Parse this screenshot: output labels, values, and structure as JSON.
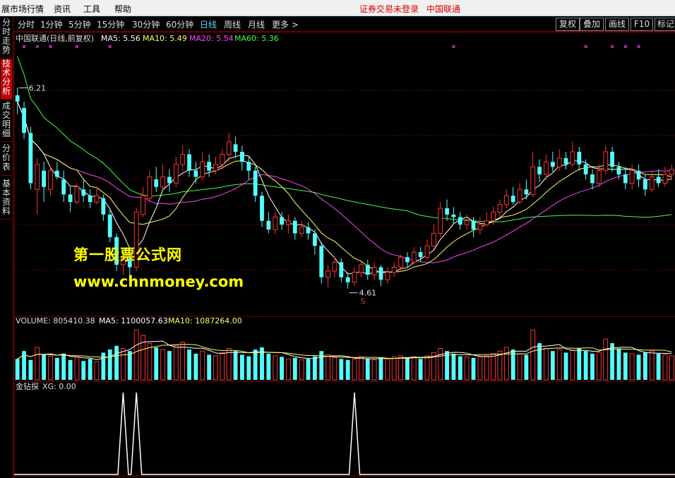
{
  "menu": {
    "items": [
      "展市场行情",
      "资讯",
      "工具",
      "帮助"
    ],
    "warning": "证券交易未登录",
    "stock": "中国联通"
  },
  "sidebar": {
    "tabs": [
      "分时走势",
      "技术分析",
      "成交明细",
      "分价表",
      "基本资料"
    ],
    "active": 1
  },
  "toolbar": {
    "periods": [
      "分时",
      "1分钟",
      "5分钟",
      "15分钟",
      "30分钟",
      "60分钟",
      "日线",
      "周线",
      "月线",
      "更多 >"
    ],
    "active": 6,
    "right_buttons": [
      "复权",
      "叠加",
      "画线",
      "F10",
      "标记"
    ]
  },
  "price_panel": {
    "title": "中国联通(日线,前复权)",
    "indicators": [
      {
        "label": "MA5: 5.56",
        "color": "#ffffff"
      },
      {
        "label": "MA10: 5.49",
        "color": "#ffff66"
      },
      {
        "label": "MA20: 5.54",
        "color": "#ff44ff"
      },
      {
        "label": "MA60: 5.36",
        "color": "#44ff44"
      }
    ],
    "high_label": "6.21",
    "low_label": "4.61",
    "low_marker": "S"
  },
  "volume_panel": {
    "title": "VOLUME: 805410.38",
    "indicators": [
      {
        "label": "MA5: 1100057.63",
        "color": "#ffffff"
      },
      {
        "label": "MA10: 1087264.00",
        "color": "#ffff66"
      }
    ]
  },
  "signal_panel": {
    "title": "金钻探",
    "value": "XG: 0.00"
  },
  "watermark": {
    "line1": "第一股票公式网",
    "line2": "www.chnmoney.com"
  },
  "colors": {
    "up": "#ff3333",
    "down": "#54ffff",
    "ma5": "#ffffff",
    "ma10": "#ffff66",
    "ma20": "#ff44ff",
    "ma60": "#44ff44",
    "marks": "#ff44ff"
  },
  "chart_data": {
    "type": "candlestick",
    "price_ylim": [
      4.4,
      6.55
    ],
    "candles": [
      [
        6.15,
        6.1,
        6.21,
        6.0
      ],
      [
        6.05,
        5.85,
        6.1,
        5.8
      ],
      [
        5.85,
        5.45,
        5.9,
        5.4
      ],
      [
        5.4,
        5.6,
        5.65,
        5.2
      ],
      [
        5.55,
        5.42,
        5.62,
        5.3
      ],
      [
        5.4,
        5.55,
        5.58,
        5.35
      ],
      [
        5.55,
        5.5,
        5.62,
        5.48
      ],
      [
        5.48,
        5.36,
        5.55,
        5.3
      ],
      [
        5.36,
        5.3,
        5.42,
        5.22
      ],
      [
        5.3,
        5.42,
        5.45,
        5.28
      ],
      [
        5.4,
        5.35,
        5.48,
        5.3
      ],
      [
        5.35,
        5.3,
        5.4,
        5.25
      ],
      [
        5.3,
        5.35,
        5.42,
        5.28
      ],
      [
        5.33,
        5.2,
        5.36,
        5.15
      ],
      [
        5.2,
        5.02,
        5.25,
        4.98
      ],
      [
        5.02,
        4.8,
        5.05,
        4.75
      ],
      [
        4.8,
        4.85,
        4.92,
        4.72
      ],
      [
        4.85,
        4.78,
        4.9,
        4.7
      ],
      [
        4.78,
        5.22,
        5.25,
        4.75
      ],
      [
        5.2,
        5.35,
        5.42,
        5.18
      ],
      [
        5.33,
        5.5,
        5.55,
        5.3
      ],
      [
        5.48,
        5.42,
        5.58,
        5.38
      ],
      [
        5.42,
        5.5,
        5.6,
        5.4
      ],
      [
        5.5,
        5.45,
        5.56,
        5.38
      ],
      [
        5.45,
        5.6,
        5.66,
        5.42
      ],
      [
        5.6,
        5.68,
        5.75,
        5.55
      ],
      [
        5.68,
        5.55,
        5.72,
        5.5
      ],
      [
        5.55,
        5.5,
        5.62,
        5.45
      ],
      [
        5.5,
        5.62,
        5.7,
        5.48
      ],
      [
        5.62,
        5.55,
        5.68,
        5.5
      ],
      [
        5.55,
        5.6,
        5.66,
        5.52
      ],
      [
        5.6,
        5.68,
        5.72,
        5.56
      ],
      [
        5.68,
        5.78,
        5.85,
        5.62
      ],
      [
        5.76,
        5.7,
        5.82,
        5.65
      ],
      [
        5.7,
        5.62,
        5.75,
        5.55
      ],
      [
        5.62,
        5.55,
        5.66,
        5.48
      ],
      [
        5.55,
        5.35,
        5.58,
        5.3
      ],
      [
        5.35,
        5.15,
        5.38,
        5.1
      ],
      [
        5.15,
        5.08,
        5.22,
        5.05
      ],
      [
        5.08,
        5.18,
        5.22,
        5.04
      ],
      [
        5.18,
        5.12,
        5.22,
        5.08
      ],
      [
        5.12,
        5.15,
        5.2,
        5.05
      ],
      [
        5.15,
        5.05,
        5.18,
        5.0
      ],
      [
        5.05,
        5.1,
        5.15,
        5.02
      ],
      [
        5.1,
        5.05,
        5.14,
        5.0
      ],
      [
        5.05,
        4.95,
        5.08,
        4.88
      ],
      [
        4.95,
        4.7,
        4.98,
        4.65
      ],
      [
        4.7,
        4.75,
        4.8,
        4.62
      ],
      [
        4.75,
        4.82,
        4.86,
        4.7
      ],
      [
        4.82,
        4.7,
        4.85,
        4.66
      ],
      [
        4.7,
        4.66,
        4.74,
        4.61
      ],
      [
        4.66,
        4.74,
        4.78,
        4.63
      ],
      [
        4.74,
        4.8,
        4.84,
        4.7
      ],
      [
        4.8,
        4.72,
        4.84,
        4.68
      ],
      [
        4.72,
        4.78,
        4.82,
        4.68
      ],
      [
        4.78,
        4.68,
        4.8,
        4.63
      ],
      [
        4.68,
        4.74,
        4.78,
        4.65
      ],
      [
        4.74,
        4.78,
        4.82,
        4.7
      ],
      [
        4.78,
        4.86,
        4.88,
        4.74
      ],
      [
        4.86,
        4.82,
        4.9,
        4.78
      ],
      [
        4.82,
        4.9,
        4.94,
        4.8
      ],
      [
        4.9,
        4.86,
        4.94,
        4.82
      ],
      [
        4.86,
        4.95,
        5.0,
        4.84
      ],
      [
        4.95,
        5.05,
        5.12,
        4.92
      ],
      [
        5.05,
        5.25,
        5.3,
        5.02
      ],
      [
        5.25,
        5.2,
        5.32,
        5.15
      ],
      [
        5.2,
        5.18,
        5.26,
        5.12
      ],
      [
        5.18,
        5.12,
        5.22,
        5.08
      ],
      [
        5.12,
        5.15,
        5.2,
        5.08
      ],
      [
        5.15,
        5.08,
        5.18,
        5.02
      ],
      [
        5.08,
        5.12,
        5.18,
        5.04
      ],
      [
        5.12,
        5.15,
        5.22,
        5.1
      ],
      [
        5.15,
        5.22,
        5.26,
        5.12
      ],
      [
        5.22,
        5.28,
        5.32,
        5.18
      ],
      [
        5.28,
        5.35,
        5.4,
        5.25
      ],
      [
        5.35,
        5.3,
        5.42,
        5.28
      ],
      [
        5.3,
        5.4,
        5.45,
        5.28
      ],
      [
        5.4,
        5.36,
        5.48,
        5.32
      ],
      [
        5.36,
        5.58,
        5.7,
        5.34
      ],
      [
        5.58,
        5.52,
        5.64,
        5.46
      ],
      [
        5.52,
        5.62,
        5.68,
        5.48
      ],
      [
        5.62,
        5.58,
        5.7,
        5.54
      ],
      [
        5.58,
        5.65,
        5.72,
        5.55
      ],
      [
        5.65,
        5.6,
        5.7,
        5.56
      ],
      [
        5.6,
        5.7,
        5.78,
        5.58
      ],
      [
        5.7,
        5.6,
        5.74,
        5.55
      ],
      [
        5.6,
        5.52,
        5.64,
        5.48
      ],
      [
        5.52,
        5.45,
        5.56,
        5.4
      ],
      [
        5.45,
        5.55,
        5.6,
        5.42
      ],
      [
        5.55,
        5.7,
        5.75,
        5.52
      ],
      [
        5.7,
        5.58,
        5.74,
        5.54
      ],
      [
        5.58,
        5.52,
        5.62,
        5.48
      ],
      [
        5.52,
        5.45,
        5.58,
        5.4
      ],
      [
        5.45,
        5.55,
        5.6,
        5.4
      ],
      [
        5.55,
        5.48,
        5.6,
        5.42
      ],
      [
        5.48,
        5.4,
        5.52,
        5.35
      ],
      [
        5.4,
        5.5,
        5.55,
        5.38
      ],
      [
        5.5,
        5.45,
        5.56,
        5.42
      ],
      [
        5.45,
        5.52,
        5.58,
        5.42
      ],
      [
        5.52,
        5.56,
        5.6,
        5.48
      ]
    ],
    "volumes": [
      40,
      55,
      38,
      62,
      48,
      45,
      42,
      50,
      38,
      44,
      36,
      40,
      35,
      52,
      58,
      65,
      60,
      55,
      95,
      85,
      70,
      62,
      58,
      55,
      66,
      72,
      58,
      50,
      55,
      48,
      46,
      52,
      60,
      55,
      48,
      45,
      58,
      62,
      50,
      46,
      44,
      40,
      42,
      38,
      40,
      45,
      55,
      48,
      42,
      40,
      38,
      40,
      44,
      40,
      38,
      42,
      40,
      44,
      46,
      42,
      44,
      40,
      46,
      52,
      60,
      55,
      50,
      45,
      44,
      42,
      44,
      46,
      50,
      55,
      62,
      58,
      50,
      48,
      95,
      70,
      60,
      55,
      58,
      52,
      56,
      60,
      55,
      50,
      52,
      78,
      70,
      60,
      52,
      50,
      48,
      52,
      55,
      50,
      48,
      46
    ],
    "signals": [
      16,
      18,
      51
    ],
    "signal_ylim": [
      0,
      1
    ]
  }
}
